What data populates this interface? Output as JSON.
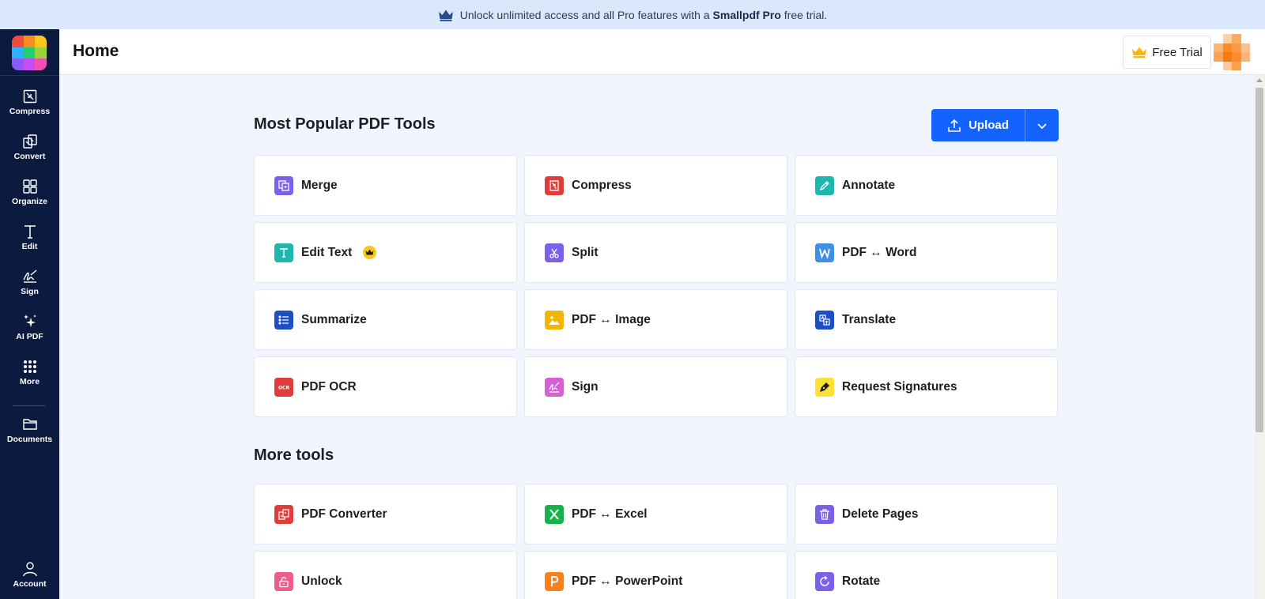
{
  "banner": {
    "text_before": "Unlock unlimited access and all Pro features with a",
    "brand": "Smallpdf Pro",
    "text_after": "free trial."
  },
  "sidebar": {
    "items": [
      {
        "label": "Compress",
        "icon": "compress-icon"
      },
      {
        "label": "Convert",
        "icon": "convert-icon"
      },
      {
        "label": "Organize",
        "icon": "organize-icon"
      },
      {
        "label": "Edit",
        "icon": "edit-text-icon"
      },
      {
        "label": "Sign",
        "icon": "signature-icon"
      },
      {
        "label": "AI PDF",
        "icon": "sparkle-icon"
      },
      {
        "label": "More",
        "icon": "grid-dots-icon"
      },
      {
        "label": "Documents",
        "icon": "folder-icon"
      },
      {
        "label": "Account",
        "icon": "user-icon"
      }
    ]
  },
  "header": {
    "title": "Home",
    "free_trial_label": "Free Trial"
  },
  "popular": {
    "title": "Most Popular PDF Tools",
    "upload_label": "Upload",
    "tools": [
      {
        "label": "Merge",
        "icon": "merge-icon",
        "color": "#7b61e8"
      },
      {
        "label": "Compress",
        "icon": "compress-icon",
        "color": "#e13c3c"
      },
      {
        "label": "Annotate",
        "icon": "pen-icon",
        "color": "#1fb6b0"
      },
      {
        "label": "Edit Text",
        "icon": "text-icon",
        "color": "#1fb6b0",
        "pro": true
      },
      {
        "label": "Split",
        "icon": "scissors-icon",
        "color": "#7b61e8"
      },
      {
        "label": "PDF ↔ Word",
        "icon": "word-icon",
        "color": "#3f8fe6"
      },
      {
        "label": "Summarize",
        "icon": "list-icon",
        "color": "#1d4fc4"
      },
      {
        "label": "PDF ↔ Image",
        "icon": "image-icon",
        "color": "#f5b400"
      },
      {
        "label": "Translate",
        "icon": "translate-icon",
        "color": "#1d4fc4"
      },
      {
        "label": "PDF OCR",
        "icon": "ocr-icon",
        "color": "#e13c3c"
      },
      {
        "label": "Sign",
        "icon": "signature-icon",
        "color": "#d65fd6"
      },
      {
        "label": "Request Signatures",
        "icon": "pen-nib-icon",
        "color": "#ffe033"
      }
    ]
  },
  "more": {
    "title": "More tools",
    "tools": [
      {
        "label": "PDF Converter",
        "icon": "convert-icon",
        "color": "#e13c3c"
      },
      {
        "label": "PDF ↔ Excel",
        "icon": "excel-icon",
        "color": "#17b34a"
      },
      {
        "label": "Delete Pages",
        "icon": "trash-icon",
        "color": "#7b61e8"
      },
      {
        "label": "Unlock",
        "icon": "unlock-icon",
        "color": "#ef5d8a"
      },
      {
        "label": "PDF ↔ PowerPoint",
        "icon": "powerpoint-icon",
        "color": "#f5821f"
      },
      {
        "label": "Rotate",
        "icon": "rotate-icon",
        "color": "#7b61e8"
      }
    ]
  },
  "colors": {
    "sidebar_bg": "#0b1a3f",
    "upload_blue": "#1463ff",
    "banner_bg": "#d9e8fb",
    "page_bg": "#f1f6fe"
  }
}
